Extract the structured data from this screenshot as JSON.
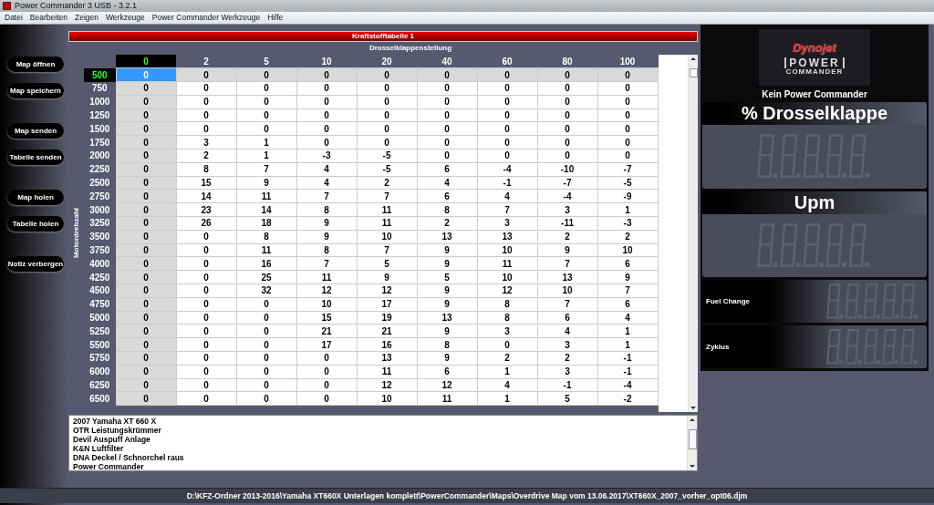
{
  "window": {
    "title": "Power Commander 3 USB - 3.2.1"
  },
  "menu": [
    "Datei",
    "Bearbeiten",
    "Zeigen",
    "Werkzeuge",
    "Power Commander Werkzeuge",
    "Hilfe"
  ],
  "button_groups": [
    [
      "Map öffnen",
      "Map speichern"
    ],
    [
      "Map senden",
      "Tabelle senden"
    ],
    [
      "Map holen",
      "Tabelle holen"
    ],
    [
      "Notiz verbergen"
    ]
  ],
  "table": {
    "title": "Kraftstofftabelle 1",
    "column_axis": "Drosselklappenstellung",
    "row_axis": "Motordrehzahl",
    "columns": [
      {
        "label": "0",
        "selected": true
      },
      {
        "label": "2",
        "selected": false
      },
      {
        "label": "5",
        "selected": false
      },
      {
        "label": "10",
        "selected": false
      },
      {
        "label": "20",
        "selected": false
      },
      {
        "label": "40",
        "selected": false
      },
      {
        "label": "60",
        "selected": false
      },
      {
        "label": "80",
        "selected": false
      },
      {
        "label": "100",
        "selected": false
      }
    ],
    "rows": [
      {
        "rpm": "500",
        "selected": true,
        "values": [
          "0",
          "0",
          "0",
          "0",
          "0",
          "0",
          "0",
          "0",
          "0"
        ]
      },
      {
        "rpm": "750",
        "selected": false,
        "values": [
          "0",
          "0",
          "0",
          "0",
          "0",
          "0",
          "0",
          "0",
          "0"
        ]
      },
      {
        "rpm": "1000",
        "selected": false,
        "values": [
          "0",
          "0",
          "0",
          "0",
          "0",
          "0",
          "0",
          "0",
          "0"
        ]
      },
      {
        "rpm": "1250",
        "selected": false,
        "values": [
          "0",
          "0",
          "0",
          "0",
          "0",
          "0",
          "0",
          "0",
          "0"
        ]
      },
      {
        "rpm": "1500",
        "selected": false,
        "values": [
          "0",
          "0",
          "0",
          "0",
          "0",
          "0",
          "0",
          "0",
          "0"
        ]
      },
      {
        "rpm": "1750",
        "selected": false,
        "values": [
          "0",
          "3",
          "1",
          "0",
          "0",
          "0",
          "0",
          "0",
          "0"
        ]
      },
      {
        "rpm": "2000",
        "selected": false,
        "values": [
          "0",
          "2",
          "1",
          "-3",
          "-5",
          "0",
          "0",
          "0",
          "0"
        ]
      },
      {
        "rpm": "2250",
        "selected": false,
        "values": [
          "0",
          "8",
          "7",
          "4",
          "-5",
          "6",
          "-4",
          "-10",
          "-7"
        ]
      },
      {
        "rpm": "2500",
        "selected": false,
        "values": [
          "0",
          "15",
          "9",
          "4",
          "2",
          "4",
          "-1",
          "-7",
          "-5"
        ]
      },
      {
        "rpm": "2750",
        "selected": false,
        "values": [
          "0",
          "14",
          "11",
          "7",
          "7",
          "6",
          "4",
          "-4",
          "-9"
        ]
      },
      {
        "rpm": "3000",
        "selected": false,
        "values": [
          "0",
          "23",
          "14",
          "8",
          "11",
          "8",
          "7",
          "3",
          "1"
        ]
      },
      {
        "rpm": "3250",
        "selected": false,
        "values": [
          "0",
          "26",
          "18",
          "9",
          "11",
          "2",
          "3",
          "-11",
          "-3"
        ]
      },
      {
        "rpm": "3500",
        "selected": false,
        "values": [
          "0",
          "0",
          "8",
          "9",
          "10",
          "13",
          "13",
          "2",
          "2"
        ]
      },
      {
        "rpm": "3750",
        "selected": false,
        "values": [
          "0",
          "0",
          "11",
          "8",
          "7",
          "9",
          "10",
          "9",
          "10"
        ]
      },
      {
        "rpm": "4000",
        "selected": false,
        "values": [
          "0",
          "0",
          "16",
          "7",
          "5",
          "9",
          "11",
          "7",
          "6"
        ]
      },
      {
        "rpm": "4250",
        "selected": false,
        "values": [
          "0",
          "0",
          "25",
          "11",
          "9",
          "5",
          "10",
          "13",
          "9"
        ]
      },
      {
        "rpm": "4500",
        "selected": false,
        "values": [
          "0",
          "0",
          "32",
          "12",
          "12",
          "9",
          "12",
          "10",
          "7"
        ]
      },
      {
        "rpm": "4750",
        "selected": false,
        "values": [
          "0",
          "0",
          "0",
          "10",
          "17",
          "9",
          "8",
          "7",
          "6"
        ]
      },
      {
        "rpm": "5000",
        "selected": false,
        "values": [
          "0",
          "0",
          "0",
          "15",
          "19",
          "13",
          "8",
          "6",
          "4"
        ]
      },
      {
        "rpm": "5250",
        "selected": false,
        "values": [
          "0",
          "0",
          "0",
          "21",
          "21",
          "9",
          "3",
          "4",
          "1"
        ]
      },
      {
        "rpm": "5500",
        "selected": false,
        "values": [
          "0",
          "0",
          "0",
          "17",
          "16",
          "8",
          "0",
          "3",
          "1"
        ]
      },
      {
        "rpm": "5750",
        "selected": false,
        "values": [
          "0",
          "0",
          "0",
          "0",
          "13",
          "9",
          "2",
          "2",
          "-1"
        ]
      },
      {
        "rpm": "6000",
        "selected": false,
        "values": [
          "0",
          "0",
          "0",
          "0",
          "11",
          "6",
          "1",
          "3",
          "-1"
        ]
      },
      {
        "rpm": "6250",
        "selected": false,
        "values": [
          "0",
          "0",
          "0",
          "0",
          "12",
          "12",
          "4",
          "-1",
          "-4"
        ]
      },
      {
        "rpm": "6500",
        "selected": false,
        "values": [
          "0",
          "0",
          "0",
          "0",
          "10",
          "11",
          "1",
          "5",
          "-2"
        ]
      }
    ]
  },
  "notes": [
    "2007 Yamaha XT 660 X",
    "OTR Leistungskrümmer",
    "Devil Auspuff Anlage",
    "K&N Luftfilter",
    "DNA Deckel / Schnorchel raus",
    "Power Commander"
  ],
  "logo": {
    "brand": "Dynojet",
    "product_top": "POWER",
    "product_bottom": "COMMANDER"
  },
  "connection_status": "Kein Power Commander",
  "gauges": [
    {
      "kind": "large",
      "label": "% Drosselklappe"
    },
    {
      "kind": "large",
      "label": "Upm"
    },
    {
      "kind": "small",
      "label": "Fuel Change"
    },
    {
      "kind": "small",
      "label": "Zyklus"
    }
  ],
  "status_bar": "D:\\KFZ-Ordner 2013-2016\\Yamaha XT660X Unterlagen komplett\\PowerCommander\\Maps\\Overdrive Map vom 13.06.2017\\XT660X_2007_vorher_opt06.djm"
}
